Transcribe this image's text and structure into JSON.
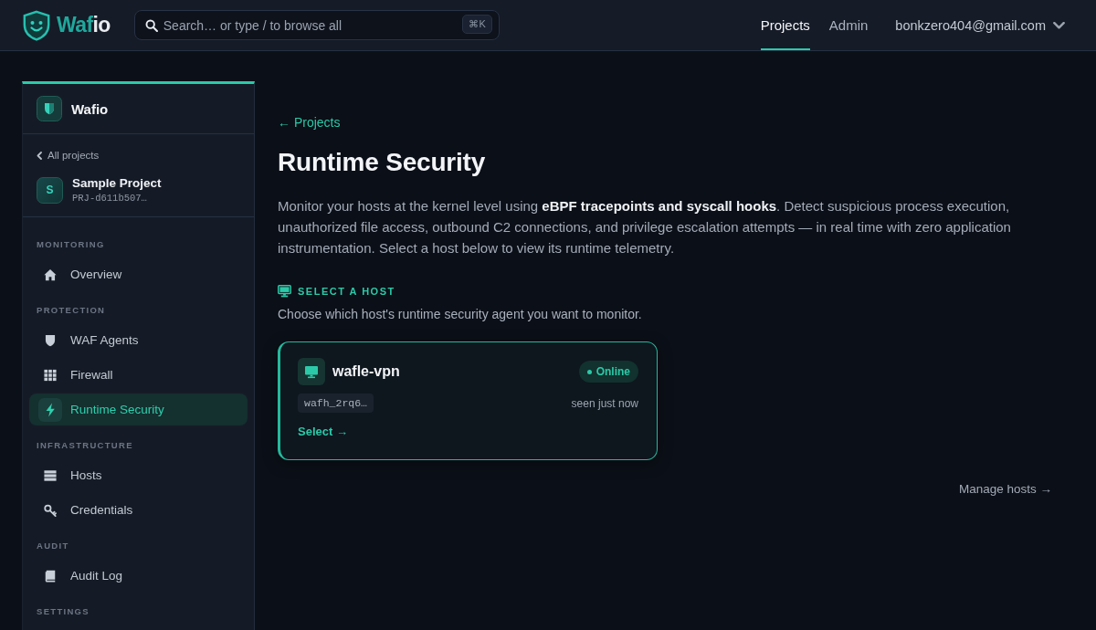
{
  "header": {
    "logo": {
      "text_accent": "Waf",
      "text_plain": "io"
    },
    "search": {
      "placeholder": "Search… or type / to browse all",
      "shortcut": "⌘K"
    },
    "nav": [
      {
        "label": "Projects",
        "selected": true
      },
      {
        "label": "Admin",
        "selected": false
      }
    ],
    "account": {
      "email": "bonkzero404@gmail.com"
    }
  },
  "sidebar": {
    "workspace": {
      "name": "Wafio"
    },
    "back_link": "All projects",
    "project": {
      "initial": "S",
      "name": "Sample Project",
      "id": "PRJ-d611b507…"
    },
    "sections": [
      {
        "title": "MONITORING",
        "items": [
          {
            "label": "Overview",
            "selected": false
          }
        ]
      },
      {
        "title": "PROTECTION",
        "items": [
          {
            "label": "WAF Agents",
            "selected": false
          },
          {
            "label": "Firewall",
            "selected": false
          },
          {
            "label": "Runtime Security",
            "selected": true
          }
        ]
      },
      {
        "title": "INFRASTRUCTURE",
        "items": [
          {
            "label": "Hosts",
            "selected": false
          },
          {
            "label": "Credentials",
            "selected": false
          }
        ]
      },
      {
        "title": "AUDIT",
        "items": [
          {
            "label": "Audit Log",
            "selected": false
          }
        ]
      },
      {
        "title": "SETTINGS"
      }
    ]
  },
  "main": {
    "breadcrumb": "← Projects",
    "title": "Runtime Security",
    "description": "Monitor your hosts at the kernel level using **eBPF tracepoints and syscall hooks**. Detect suspicious process execution, unauthorized file access, outbound C2 connections, and privilege escalation attempts — in real time with zero application instrumentation. Select a host below to view its runtime telemetry.",
    "host_picker": {
      "heading": "SELECT A HOST",
      "subtitle": "Choose which host's runtime security agent you want to monitor.",
      "hosts": [
        {
          "name": "wafle-vpn",
          "status": "Online",
          "online": true,
          "id": "wafh_2rq6…",
          "last_seen": "seen just now",
          "action": "Select →",
          "selected": true
        }
      ]
    },
    "manage_link": "Manage hosts →"
  }
}
